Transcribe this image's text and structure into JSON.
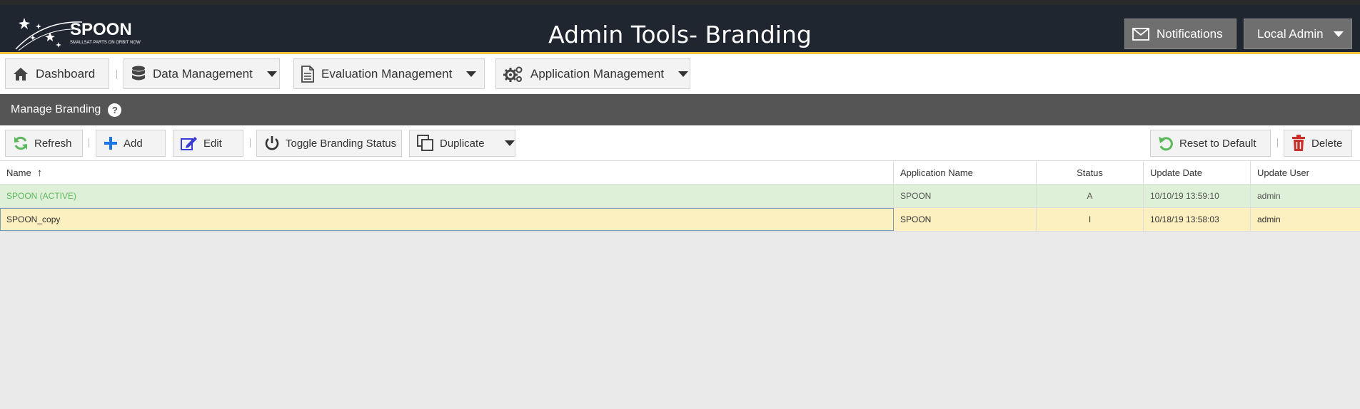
{
  "header": {
    "logo_text": "SPOON",
    "logo_tagline": "SMALLSAT PARTS ON ORBIT NOW",
    "title": "Admin Tools- Branding",
    "notifications_label": "Notifications",
    "user_label": "Local Admin"
  },
  "nav": {
    "dashboard": "Dashboard",
    "data_management": "Data Management",
    "evaluation_management": "Evaluation Management",
    "application_management": "Application Management"
  },
  "section": {
    "title": "Manage Branding",
    "help": "?"
  },
  "toolbar": {
    "refresh": "Refresh",
    "add": "Add",
    "edit": "Edit",
    "toggle": "Toggle Branding Status",
    "duplicate": "Duplicate",
    "reset": "Reset to Default",
    "delete": "Delete"
  },
  "grid": {
    "columns": [
      "Name",
      "Application Name",
      "Status",
      "Update Date",
      "Update User"
    ],
    "sort_indicator": "↑",
    "rows": [
      {
        "name": "SPOON (ACTIVE)",
        "app": "SPOON",
        "status": "A",
        "date": "10/10/19 13:59:10",
        "user": "admin"
      },
      {
        "name": "SPOON_copy",
        "app": "SPOON",
        "status": "I",
        "date": "10/18/19 13:58:03",
        "user": "admin"
      }
    ]
  },
  "colors": {
    "header_bg": "#1f2630",
    "accent": "#f5c242",
    "section_bg": "#555555",
    "active_row": "#dff0d8",
    "selected_row": "#fcf0c0"
  }
}
